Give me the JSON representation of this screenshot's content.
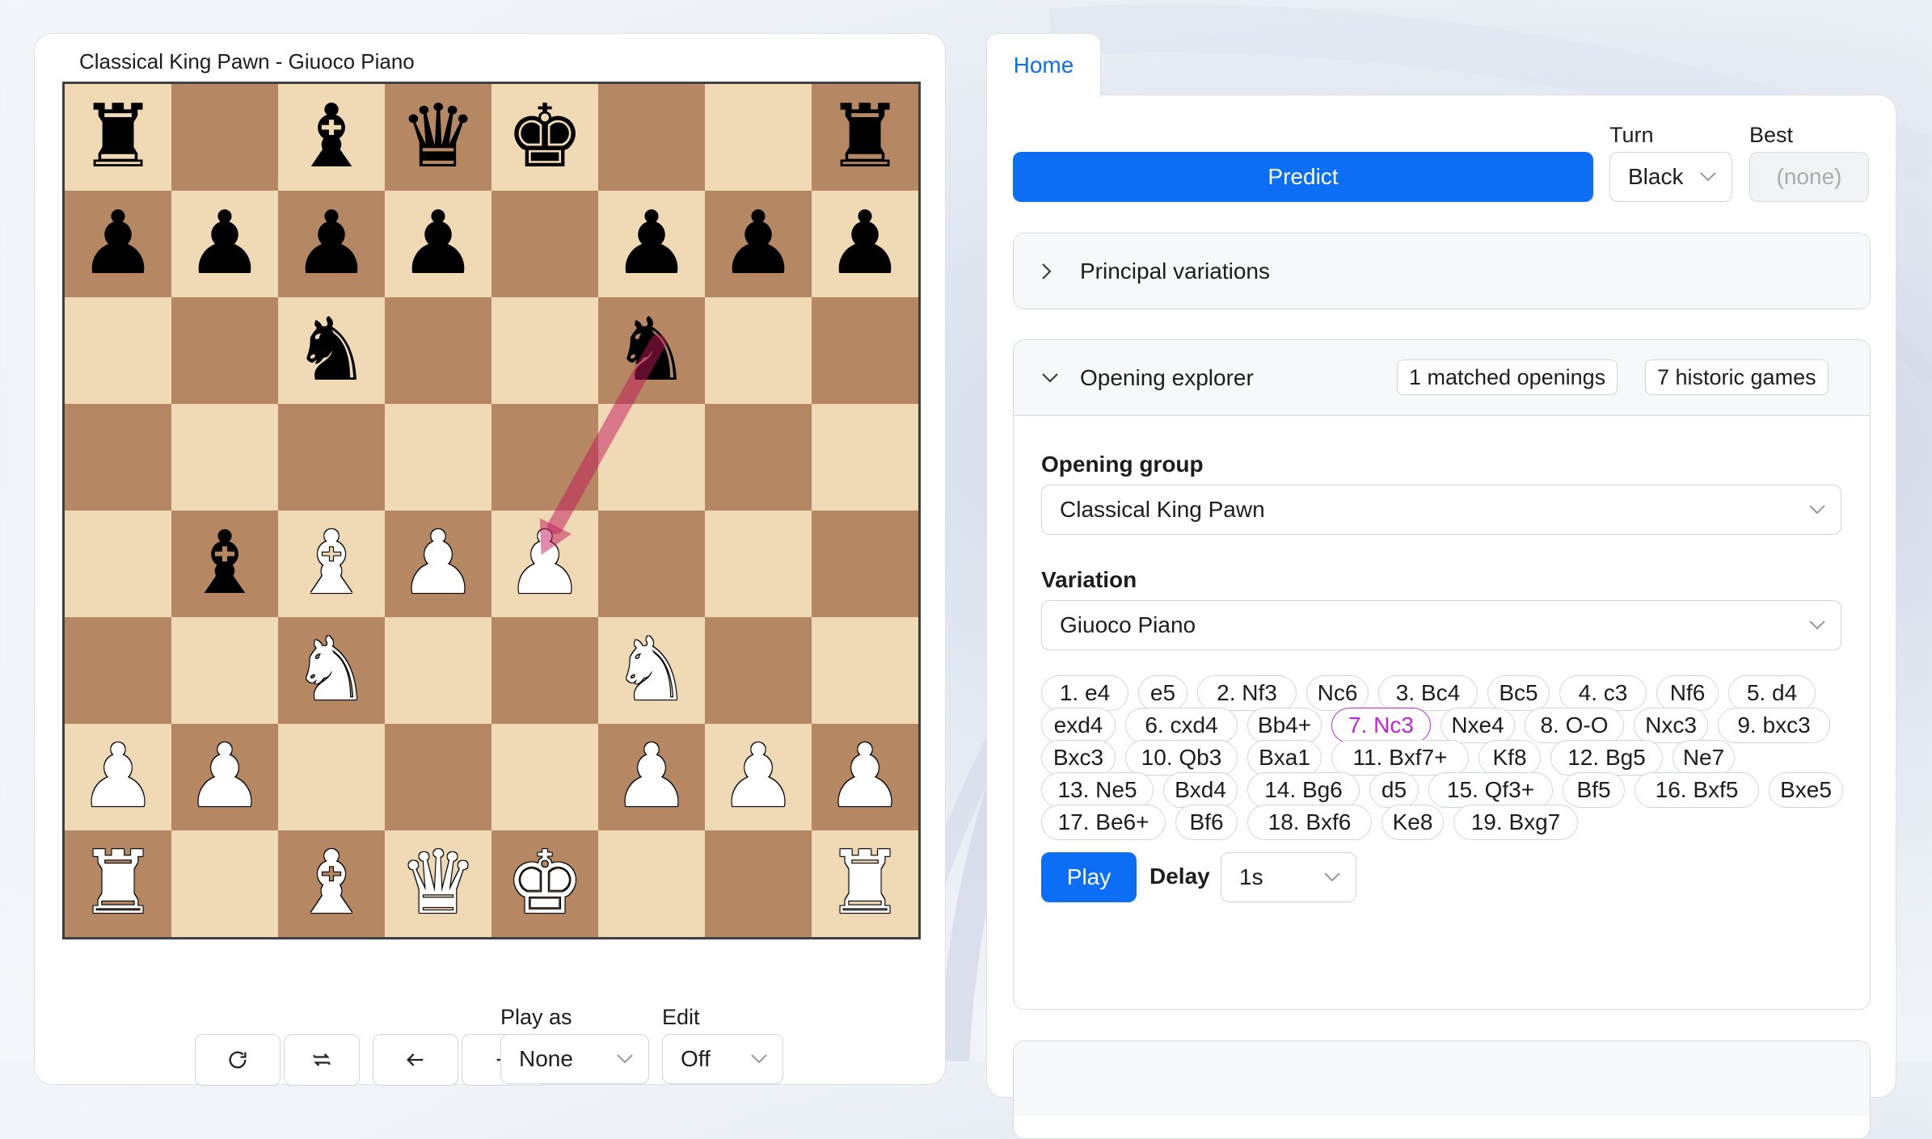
{
  "board": {
    "title": "Classical King Pawn - Giuoco Piano",
    "squares": [
      [
        {
          "p": "♜",
          "c": "black"
        },
        null,
        {
          "p": "♝",
          "c": "black"
        },
        {
          "p": "♛",
          "c": "black"
        },
        {
          "p": "♚",
          "c": "black"
        },
        null,
        null,
        {
          "p": "♜",
          "c": "black"
        }
      ],
      [
        {
          "p": "♟",
          "c": "black"
        },
        {
          "p": "♟",
          "c": "black"
        },
        {
          "p": "♟",
          "c": "black"
        },
        {
          "p": "♟",
          "c": "black"
        },
        null,
        {
          "p": "♟",
          "c": "black"
        },
        {
          "p": "♟",
          "c": "black"
        },
        {
          "p": "♟",
          "c": "black"
        }
      ],
      [
        null,
        null,
        {
          "p": "♞",
          "c": "black"
        },
        null,
        null,
        {
          "p": "♞",
          "c": "black"
        },
        null,
        null
      ],
      [
        null,
        null,
        null,
        null,
        null,
        null,
        null,
        null
      ],
      [
        null,
        {
          "p": "♝",
          "c": "black"
        },
        {
          "p": "♝",
          "c": "white"
        },
        {
          "p": "♟",
          "c": "white"
        },
        {
          "p": "♟",
          "c": "white"
        },
        null,
        null,
        null
      ],
      [
        null,
        null,
        {
          "p": "♞",
          "c": "white"
        },
        null,
        null,
        {
          "p": "♞",
          "c": "white"
        },
        null,
        null
      ],
      [
        {
          "p": "♟",
          "c": "white"
        },
        {
          "p": "♟",
          "c": "white"
        },
        null,
        null,
        null,
        {
          "p": "♟",
          "c": "white"
        },
        {
          "p": "♟",
          "c": "white"
        },
        {
          "p": "♟",
          "c": "white"
        }
      ],
      [
        {
          "p": "♜",
          "c": "white"
        },
        null,
        {
          "p": "♝",
          "c": "white"
        },
        {
          "p": "♛",
          "c": "white"
        },
        {
          "p": "♚",
          "c": "white"
        },
        null,
        null,
        {
          "p": "♜",
          "c": "white"
        }
      ]
    ],
    "arrow": {
      "from": "f6",
      "to": "e4",
      "color": "#c2185b"
    }
  },
  "controls": {
    "play_as_label": "Play as",
    "play_as_value": "None",
    "edit_label": "Edit",
    "edit_value": "Off"
  },
  "tabs": {
    "home": "Home"
  },
  "predict": {
    "button": "Predict",
    "turn_label": "Turn",
    "turn_value": "Black",
    "best_label": "Best",
    "best_value": "(none)"
  },
  "principal_variations": {
    "title": "Principal variations"
  },
  "opening_explorer": {
    "title": "Opening explorer",
    "matched": "1 matched openings",
    "historic": "7 historic games",
    "group_label": "Opening group",
    "group_value": "Classical King Pawn",
    "variation_label": "Variation",
    "variation_value": "Giuoco Piano",
    "moves": [
      "1. e4",
      "e5",
      "2. Nf3",
      "Nc6",
      "3. Bc4",
      "Bc5",
      "4. c3",
      "Nf6",
      "5. d4",
      "exd4",
      "6. cxd4",
      "Bb4+",
      "7. Nc3",
      "Nxe4",
      "8. O-O",
      "Nxc3",
      "9. bxc3",
      "Bxc3",
      "10. Qb3",
      "Bxa1",
      "11. Bxf7+",
      "Kf8",
      "12. Bg5",
      "Ne7",
      "13. Ne5",
      "Bxd4",
      "14. Bg6",
      "d5",
      "15. Qf3+",
      "Bf5",
      "16. Bxf5",
      "Bxe5",
      "17. Be6+",
      "Bf6",
      "18. Bxf6",
      "Ke8",
      "19. Bxg7"
    ],
    "active_move": "7. Nc3",
    "play_button": "Play",
    "delay_label": "Delay",
    "delay_value": "1s"
  },
  "colors": {
    "accent": "#0b6ef5",
    "active_move": "#c026d3",
    "light_square": "#f0d9b5",
    "dark_square": "#b58863"
  }
}
